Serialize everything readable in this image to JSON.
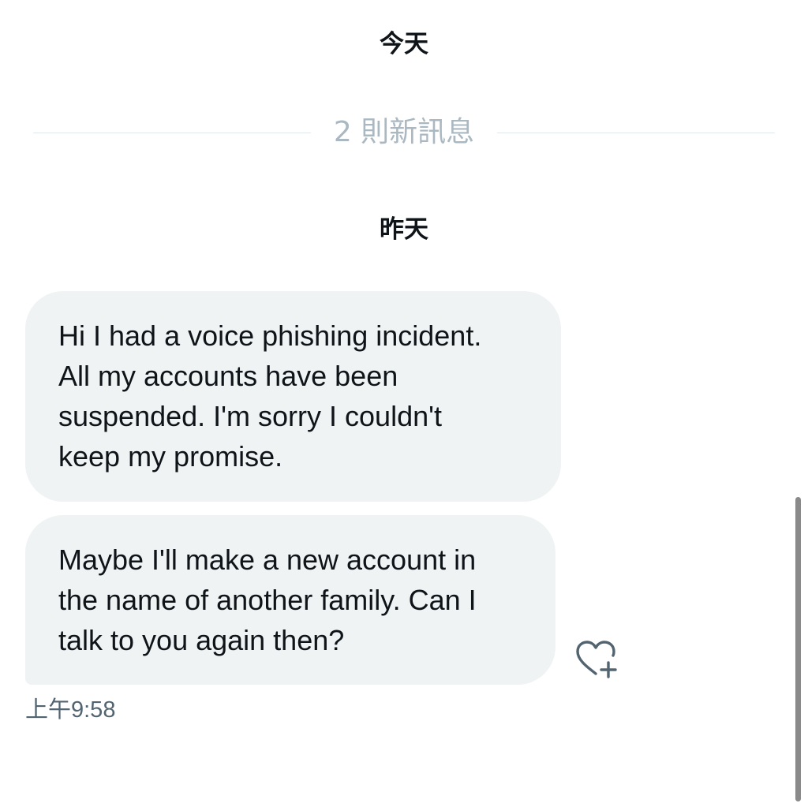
{
  "dates": {
    "today": "今天",
    "yesterday": "昨天"
  },
  "new_messages_label": "2 則新訊息",
  "messages": [
    {
      "lines": [
        "Hi I had a voice phishing incident.",
        "All my accounts have been",
        "suspended. I'm sorry I couldn't",
        "keep my promise."
      ]
    },
    {
      "lines": [
        "Maybe I'll make a new account in",
        "the name of another family. Can I",
        "talk to you again then?"
      ],
      "timestamp": "上午9:58"
    }
  ],
  "icons": {
    "react": "heart-plus-icon"
  },
  "colors": {
    "bubble_bg": "#eff3f4",
    "text": "#0f1419",
    "muted": "#536471",
    "divider_text": "#aab8c2"
  }
}
